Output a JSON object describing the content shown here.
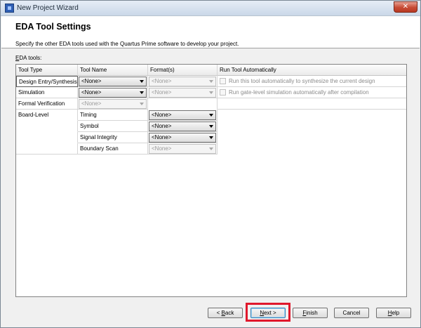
{
  "window": {
    "title": "New Project Wizard",
    "close_glyph": "✕"
  },
  "header": {
    "title": "EDA Tool Settings",
    "description": "Specify the other EDA tools used with the Quartus Prime software to develop your project."
  },
  "section": {
    "label_mnemonic": "E",
    "label_rest": "DA tools:"
  },
  "columns": [
    "Tool Type",
    "Tool Name",
    "Format(s)",
    "Run Tool Automatically"
  ],
  "rows": [
    {
      "tool_type": "Design Entry/Synthesis",
      "tool_name": "<None>",
      "format": "<None>",
      "auto": "Run this tool automatically to synthesize the current design"
    },
    {
      "tool_type": "Simulation",
      "tool_name": "<None>",
      "format": "<None>",
      "auto": "Run gate-level simulation automatically after compilation"
    },
    {
      "tool_type": "Formal Verification",
      "tool_name": "<None>",
      "format": "",
      "auto": ""
    },
    {
      "tool_type": "Board-Level",
      "tool_name": "Timing",
      "format": "<None>",
      "auto": ""
    },
    {
      "tool_type": "",
      "tool_name": "Symbol",
      "format": "<None>",
      "auto": ""
    },
    {
      "tool_type": "",
      "tool_name": "Signal Integrity",
      "format": "<None>",
      "auto": ""
    },
    {
      "tool_type": "",
      "tool_name": "Boundary Scan",
      "format": "<None>",
      "auto": ""
    }
  ],
  "buttons": {
    "back_mnemonic": "B",
    "back_prefix": "< ",
    "back_rest": "ack",
    "next_mnemonic": "N",
    "next_rest": "ext >",
    "finish_mnemonic": "F",
    "finish_rest": "inish",
    "cancel": "Cancel",
    "help_mnemonic": "H",
    "help_rest": "elp"
  },
  "colors": {
    "highlight": "#e0182c",
    "title_bar": "#cad8e8"
  }
}
